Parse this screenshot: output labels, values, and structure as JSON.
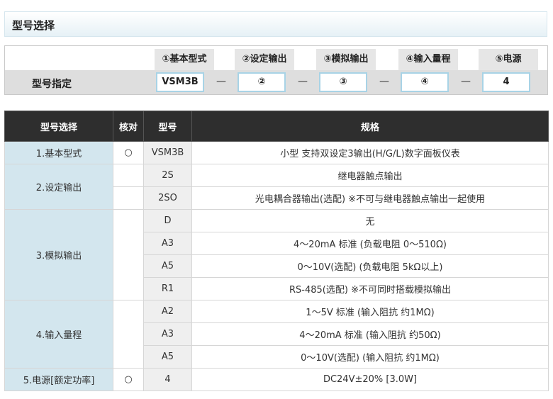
{
  "title": "型号选择",
  "selector": {
    "row_label": "型号指定",
    "headers": [
      "①基本型式",
      "②设定输出",
      "③模拟输出",
      "④输入量程",
      "⑤电源"
    ],
    "values": [
      "VSM3B",
      "②",
      "③",
      "④",
      "4"
    ],
    "dash": "—"
  },
  "table": {
    "headers": [
      "型号选择",
      "核对",
      "型号",
      "规格"
    ],
    "groups": [
      {
        "label": "1.基本型式",
        "check": "○",
        "rows": [
          {
            "model": "VSM3B",
            "spec": "小型 支持双设定3输出(H/G/L)数字面板仪表"
          }
        ]
      },
      {
        "label": "2.设定输出",
        "check": "",
        "rows": [
          {
            "model": "2S",
            "spec": "继电器触点输出"
          },
          {
            "model": "2SO",
            "spec": "光电耦合器输出(选配) ※不可与继电器触点输出一起使用"
          }
        ]
      },
      {
        "label": "3.模拟输出",
        "check": "",
        "rows": [
          {
            "model": "D",
            "spec": "无"
          },
          {
            "model": "A3",
            "spec": "4～20mA 标准 (负载电阻 0～510Ω)"
          },
          {
            "model": "A5",
            "spec": "0～10V(选配) (负载电阻 5kΩ以上)"
          },
          {
            "model": "R1",
            "spec": "RS-485(选配) ※不可同时搭载模拟输出"
          }
        ]
      },
      {
        "label": "4.输入量程",
        "check": "",
        "rows": [
          {
            "model": "A2",
            "spec": "1～5V 标准 (输入阻抗 约1MΩ)"
          },
          {
            "model": "A3",
            "spec": "4～20mA 标准 (输入阻抗 约50Ω)"
          },
          {
            "model": "A5",
            "spec": "0～10V(选配) (输入阻抗 约1MΩ)"
          }
        ]
      },
      {
        "label": "5.电源[额定功率]",
        "check": "○",
        "rows": [
          {
            "model": "4",
            "spec": "DC24V±20% [3.0W]"
          }
        ]
      }
    ]
  }
}
